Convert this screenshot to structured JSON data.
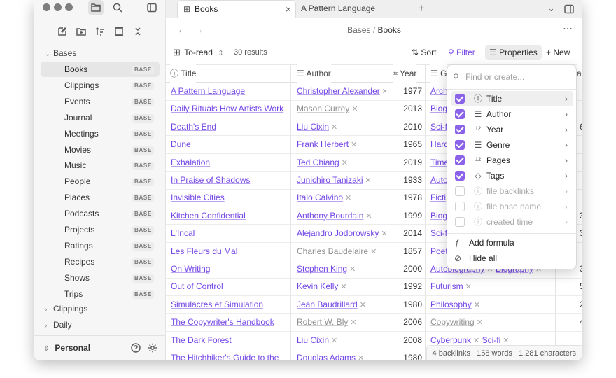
{
  "tabs": [
    {
      "label": "Books"
    },
    {
      "label": "A Pattern Language"
    }
  ],
  "breadcrumb": {
    "parent": "Bases",
    "sep": "/",
    "current": "Books"
  },
  "sidebar": {
    "section": "Bases",
    "badge": "BASE",
    "items": [
      "Books",
      "Clippings",
      "Events",
      "Journal",
      "Meetings",
      "Movies",
      "Music",
      "People",
      "Places",
      "Podcasts",
      "Projects",
      "Ratings",
      "Recipes",
      "Shows",
      "Trips"
    ],
    "folders": [
      "Clippings",
      "Daily"
    ],
    "vault": "Personal"
  },
  "toolbar": {
    "view": "To-read",
    "count": "30 results",
    "sort": "Sort",
    "filter": "Filter",
    "properties": "Properties",
    "new": "New"
  },
  "columns": {
    "title": "Title",
    "author": "Author",
    "year": "Year",
    "genre": "G",
    "extra": "ag"
  },
  "rows": [
    {
      "title": "A Pattern Language",
      "author": "Christopher Alexander",
      "author_muted": false,
      "year": "1977",
      "genre": "Arch",
      "genre_muted": false,
      "extra": ""
    },
    {
      "title": "Daily Rituals How Artists Work",
      "author": "Mason Currey",
      "author_muted": true,
      "year": "2013",
      "genre": "Biog",
      "genre_muted": false,
      "extra": ""
    },
    {
      "title": "Death's End",
      "author": "Liu Cixin",
      "author_muted": false,
      "year": "2010",
      "genre": "Sci-f",
      "genre_muted": false,
      "extra": "6"
    },
    {
      "title": "Dune",
      "author": "Frank Herbert",
      "author_muted": false,
      "year": "1965",
      "genre": "Hard",
      "genre_muted": false,
      "extra": ""
    },
    {
      "title": "Exhalation",
      "author": "Ted Chiang",
      "author_muted": false,
      "year": "2019",
      "genre": "Time",
      "genre_muted": false,
      "extra": ""
    },
    {
      "title": "In Praise of Shadows",
      "author": "Junichiro Tanizaki",
      "author_muted": false,
      "year": "1933",
      "genre": "Auto",
      "genre_muted": false,
      "extra": ""
    },
    {
      "title": "Invisible Cities",
      "author": "Italo Calvino",
      "author_muted": false,
      "year": "1978",
      "genre": "Ficti",
      "genre_muted": false,
      "extra": ""
    },
    {
      "title": "Kitchen Confidential",
      "author": "Anthony Bourdain",
      "author_muted": false,
      "year": "1999",
      "genre": "Biog",
      "genre_muted": false,
      "extra": "3"
    },
    {
      "title": "L'Incal",
      "author": "Alejandro Jodorowsky",
      "author_muted": false,
      "year": "2014",
      "genre": "Sci-f",
      "genre_muted": false,
      "extra": "3"
    },
    {
      "title": "Les Fleurs du Mal",
      "author": "Charles Baudelaire",
      "author_muted": true,
      "year": "1857",
      "genre": "Poet",
      "genre_muted": false,
      "extra": ""
    },
    {
      "title": "On Writing",
      "author": "Stephen King",
      "author_muted": false,
      "year": "2000",
      "genre": "Autobiography",
      "genre2": "Biography",
      "genre_muted": false,
      "extra": "3"
    },
    {
      "title": "Out of Control",
      "author": "Kevin Kelly",
      "author_muted": false,
      "year": "1992",
      "genre": "Futurism",
      "genre_muted": false,
      "extra": "5"
    },
    {
      "title": "Simulacres et Simulation",
      "author": "Jean Baudrillard",
      "author_muted": false,
      "year": "1980",
      "genre": "Philosophy",
      "genre_muted": false,
      "extra": "2"
    },
    {
      "title": "The Copywriter's Handbook",
      "author": "Robert W. Bly",
      "author_muted": true,
      "year": "2006",
      "genre": "Copywriting",
      "genre_muted": true,
      "extra": "4"
    },
    {
      "title": "The Dark Forest",
      "author": "Liu Cixin",
      "author_muted": false,
      "year": "2008",
      "genre": "Cyberpunk",
      "genre2": "Sci-fi",
      "genre_muted": false,
      "extra": ""
    },
    {
      "title": "The Hitchhiker's Guide to the",
      "author": "Douglas Adams",
      "author_muted": false,
      "year": "1980",
      "genre": "",
      "genre_muted": false,
      "extra": ""
    }
  ],
  "popup": {
    "search_placeholder": "Find or create...",
    "props": [
      {
        "name": "Title",
        "icon": "info-icon",
        "checked": true,
        "dim": false
      },
      {
        "name": "Author",
        "icon": "list-icon",
        "checked": true,
        "dim": false
      },
      {
        "name": "Year",
        "icon": "number-icon",
        "checked": true,
        "dim": false
      },
      {
        "name": "Genre",
        "icon": "list-icon",
        "checked": true,
        "dim": false
      },
      {
        "name": "Pages",
        "icon": "number-icon",
        "checked": true,
        "dim": false
      },
      {
        "name": "Tags",
        "icon": "tags-icon",
        "checked": true,
        "dim": false
      },
      {
        "name": "file backlinks",
        "icon": "info-icon",
        "checked": false,
        "dim": true
      },
      {
        "name": "file base name",
        "icon": "info-icon",
        "checked": false,
        "dim": true
      },
      {
        "name": "created time",
        "icon": "info-icon",
        "checked": false,
        "dim": true
      }
    ],
    "add_formula": "Add formula",
    "hide_all": "Hide all"
  },
  "status": {
    "backlinks": "4 backlinks",
    "words": "158 words",
    "chars": "1,281 characters"
  }
}
